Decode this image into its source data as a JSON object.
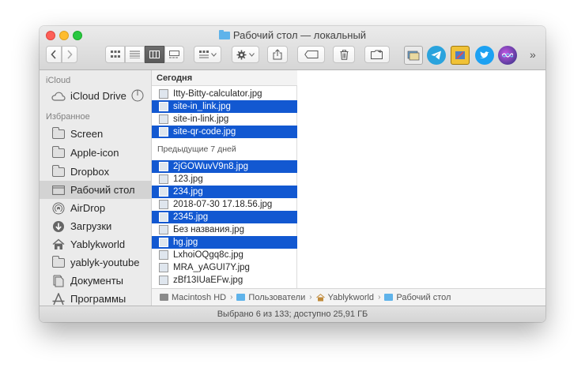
{
  "window": {
    "title": "Рабочий стол — локальный",
    "status": "Выбрано 6 из 133; доступно 25,91 ГБ"
  },
  "toolbar": {
    "back_icon": "chevron-left-icon",
    "forward_icon": "chevron-right-icon",
    "view_modes": [
      "icon-view",
      "list-view",
      "column-view",
      "gallery-view"
    ],
    "active_view": "column-view",
    "more": "»"
  },
  "sidebar": {
    "icloud_section": "iCloud",
    "icloud_drive": "iCloud Drive",
    "favorites_section": "Избранное",
    "items": [
      {
        "label": "Screen",
        "icon": "folder-icon"
      },
      {
        "label": "Apple-icon",
        "icon": "folder-icon"
      },
      {
        "label": "Dropbox",
        "icon": "folder-icon"
      },
      {
        "label": "Рабочий стол",
        "icon": "desktop-icon",
        "selected": true
      },
      {
        "label": "AirDrop",
        "icon": "airdrop-icon"
      },
      {
        "label": "Загрузки",
        "icon": "downloads-icon"
      },
      {
        "label": "Yablykworld",
        "icon": "home-icon"
      },
      {
        "label": "yablyk-youtube",
        "icon": "folder-icon"
      },
      {
        "label": "Документы",
        "icon": "documents-icon"
      },
      {
        "label": "Программы",
        "icon": "applications-icon"
      }
    ]
  },
  "column": {
    "header": "Сегодня",
    "today_files": [
      {
        "name": "Itty-Bitty-calculator.jpg",
        "selected": false
      },
      {
        "name": "site-in_link.jpg",
        "selected": true
      },
      {
        "name": "site-in-link.jpg",
        "selected": false
      },
      {
        "name": "site-qr-code.jpg",
        "selected": true
      }
    ],
    "prev_label": "Предыдущие 7 дней",
    "prev_files": [
      {
        "name": "2jGOWuvV9n8.jpg",
        "selected": true
      },
      {
        "name": "123.jpg",
        "selected": false
      },
      {
        "name": "234.jpg",
        "selected": true
      },
      {
        "name": "2018-07-30 17.18.56.jpg",
        "selected": false
      },
      {
        "name": "2345.jpg",
        "selected": true
      },
      {
        "name": "Без названия.jpg",
        "selected": false
      },
      {
        "name": "hg.jpg",
        "selected": true
      },
      {
        "name": "LxhoiOQgq8c.jpg",
        "selected": false
      },
      {
        "name": "MRA_yAGUI7Y.jpg",
        "selected": false
      },
      {
        "name": "zBf13IUaEFw.jpg",
        "selected": false
      }
    ]
  },
  "pathbar": [
    "Macintosh HD",
    "Пользователи",
    "Yablykworld",
    "Рабочий стол"
  ],
  "colors": {
    "selection": "#1258d1",
    "sidebar_bg": "#ebebeb",
    "folder_blue": "#5fb3ea"
  }
}
